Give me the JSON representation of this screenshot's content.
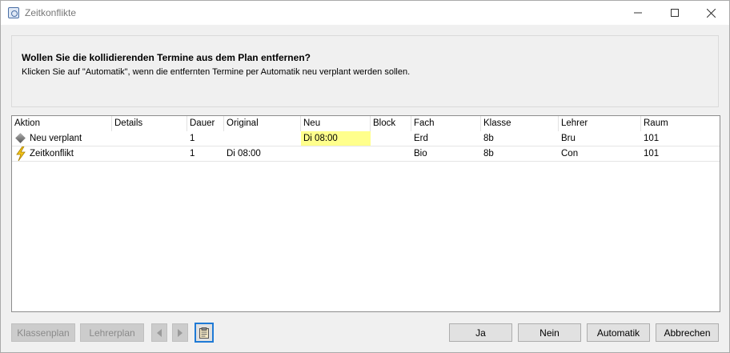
{
  "window": {
    "title": "Zeitkonflikte",
    "minimize_icon": "minimize-icon",
    "maximize_icon": "maximize-icon",
    "close_icon": "close-icon"
  },
  "header": {
    "question": "Wollen Sie die kollidierenden Termine aus dem Plan entfernen?",
    "hint": "Klicken Sie auf \"Automatik\", wenn die entfernten Termine per Automatik neu verplant werden sollen."
  },
  "table": {
    "columns": [
      "Aktion",
      "Details",
      "Dauer",
      "Original",
      "Neu",
      "Block",
      "Fach",
      "Klasse",
      "Lehrer",
      "Raum"
    ],
    "rows": [
      {
        "icon": "diamond-icon",
        "aktion": "Neu verplant",
        "details": "",
        "dauer": "1",
        "original": "",
        "neu": "Di 08:00",
        "block": "",
        "fach": "Erd",
        "klasse": "8b",
        "lehrer": "Bru",
        "raum": "101"
      },
      {
        "icon": "lightning-icon",
        "aktion": "Zeitkonflikt",
        "details": "",
        "dauer": "1",
        "original": "Di 08:00",
        "neu": "",
        "block": "",
        "fach": "Bio",
        "klasse": "8b",
        "lehrer": "Con",
        "raum": "101"
      }
    ],
    "highlight_color": "#ffff8c"
  },
  "buttons": {
    "klassenplan": "Klassenplan",
    "lehrerplan": "Lehrerplan",
    "prev_icon": "triangle-left-icon",
    "next_icon": "triangle-right-icon",
    "clipboard_icon": "clipboard-icon",
    "ja": "Ja",
    "nein": "Nein",
    "automatik": "Automatik",
    "abbrechen": "Abbrechen"
  }
}
